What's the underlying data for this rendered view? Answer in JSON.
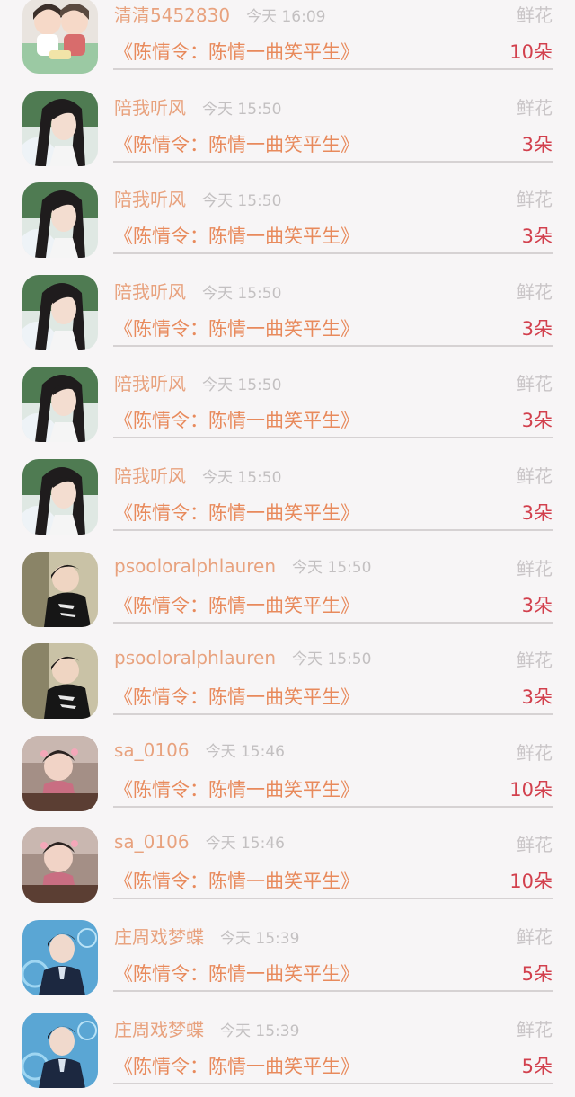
{
  "gift_records": [
    {
      "username": "清清5452830",
      "time": "今天 16:09",
      "gift_type": "鲜花",
      "book_title": "《陈情令：陈情一曲笑平生》",
      "quantity": "10朵",
      "avatar_icon": "avatar-couple-cartoon-icon"
    },
    {
      "username": "陪我听风",
      "time": "今天 15:50",
      "gift_type": "鲜花",
      "book_title": "《陈情令：陈情一曲笑平生》",
      "quantity": "3朵",
      "avatar_icon": "avatar-longhair-man-icon"
    },
    {
      "username": "陪我听风",
      "time": "今天 15:50",
      "gift_type": "鲜花",
      "book_title": "《陈情令：陈情一曲笑平生》",
      "quantity": "3朵",
      "avatar_icon": "avatar-longhair-man-icon"
    },
    {
      "username": "陪我听风",
      "time": "今天 15:50",
      "gift_type": "鲜花",
      "book_title": "《陈情令：陈情一曲笑平生》",
      "quantity": "3朵",
      "avatar_icon": "avatar-longhair-man-icon"
    },
    {
      "username": "陪我听风",
      "time": "今天 15:50",
      "gift_type": "鲜花",
      "book_title": "《陈情令：陈情一曲笑平生》",
      "quantity": "3朵",
      "avatar_icon": "avatar-longhair-man-icon"
    },
    {
      "username": "陪我听风",
      "time": "今天 15:50",
      "gift_type": "鲜花",
      "book_title": "《陈情令：陈情一曲笑平生》",
      "quantity": "3朵",
      "avatar_icon": "avatar-longhair-man-icon"
    },
    {
      "username": "psooloralphlauren",
      "time": "今天 15:50",
      "gift_type": "鲜花",
      "book_title": "《陈情令：陈情一曲笑平生》",
      "quantity": "3朵",
      "avatar_icon": "avatar-man-black-shirt-icon"
    },
    {
      "username": "psooloralphlauren",
      "time": "今天 15:50",
      "gift_type": "鲜花",
      "book_title": "《陈情令：陈情一曲笑平生》",
      "quantity": "3朵",
      "avatar_icon": "avatar-man-black-shirt-icon"
    },
    {
      "username": "sa_0106",
      "time": "今天 15:46",
      "gift_type": "鲜花",
      "book_title": "《陈情令：陈情一曲笑平生》",
      "quantity": "10朵",
      "avatar_icon": "avatar-child-icon"
    },
    {
      "username": "sa_0106",
      "time": "今天 15:46",
      "gift_type": "鲜花",
      "book_title": "《陈情令：陈情一曲笑平生》",
      "quantity": "10朵",
      "avatar_icon": "avatar-child-icon"
    },
    {
      "username": "庄周戏梦蝶",
      "time": "今天 15:39",
      "gift_type": "鲜花",
      "book_title": "《陈情令：陈情一曲笑平生》",
      "quantity": "5朵",
      "avatar_icon": "avatar-man-blue-stage-icon"
    },
    {
      "username": "庄周戏梦蝶",
      "time": "今天 15:39",
      "gift_type": "鲜花",
      "book_title": "《陈情令：陈情一曲笑平生》",
      "quantity": "5朵",
      "avatar_icon": "avatar-man-blue-stage-icon"
    }
  ]
}
